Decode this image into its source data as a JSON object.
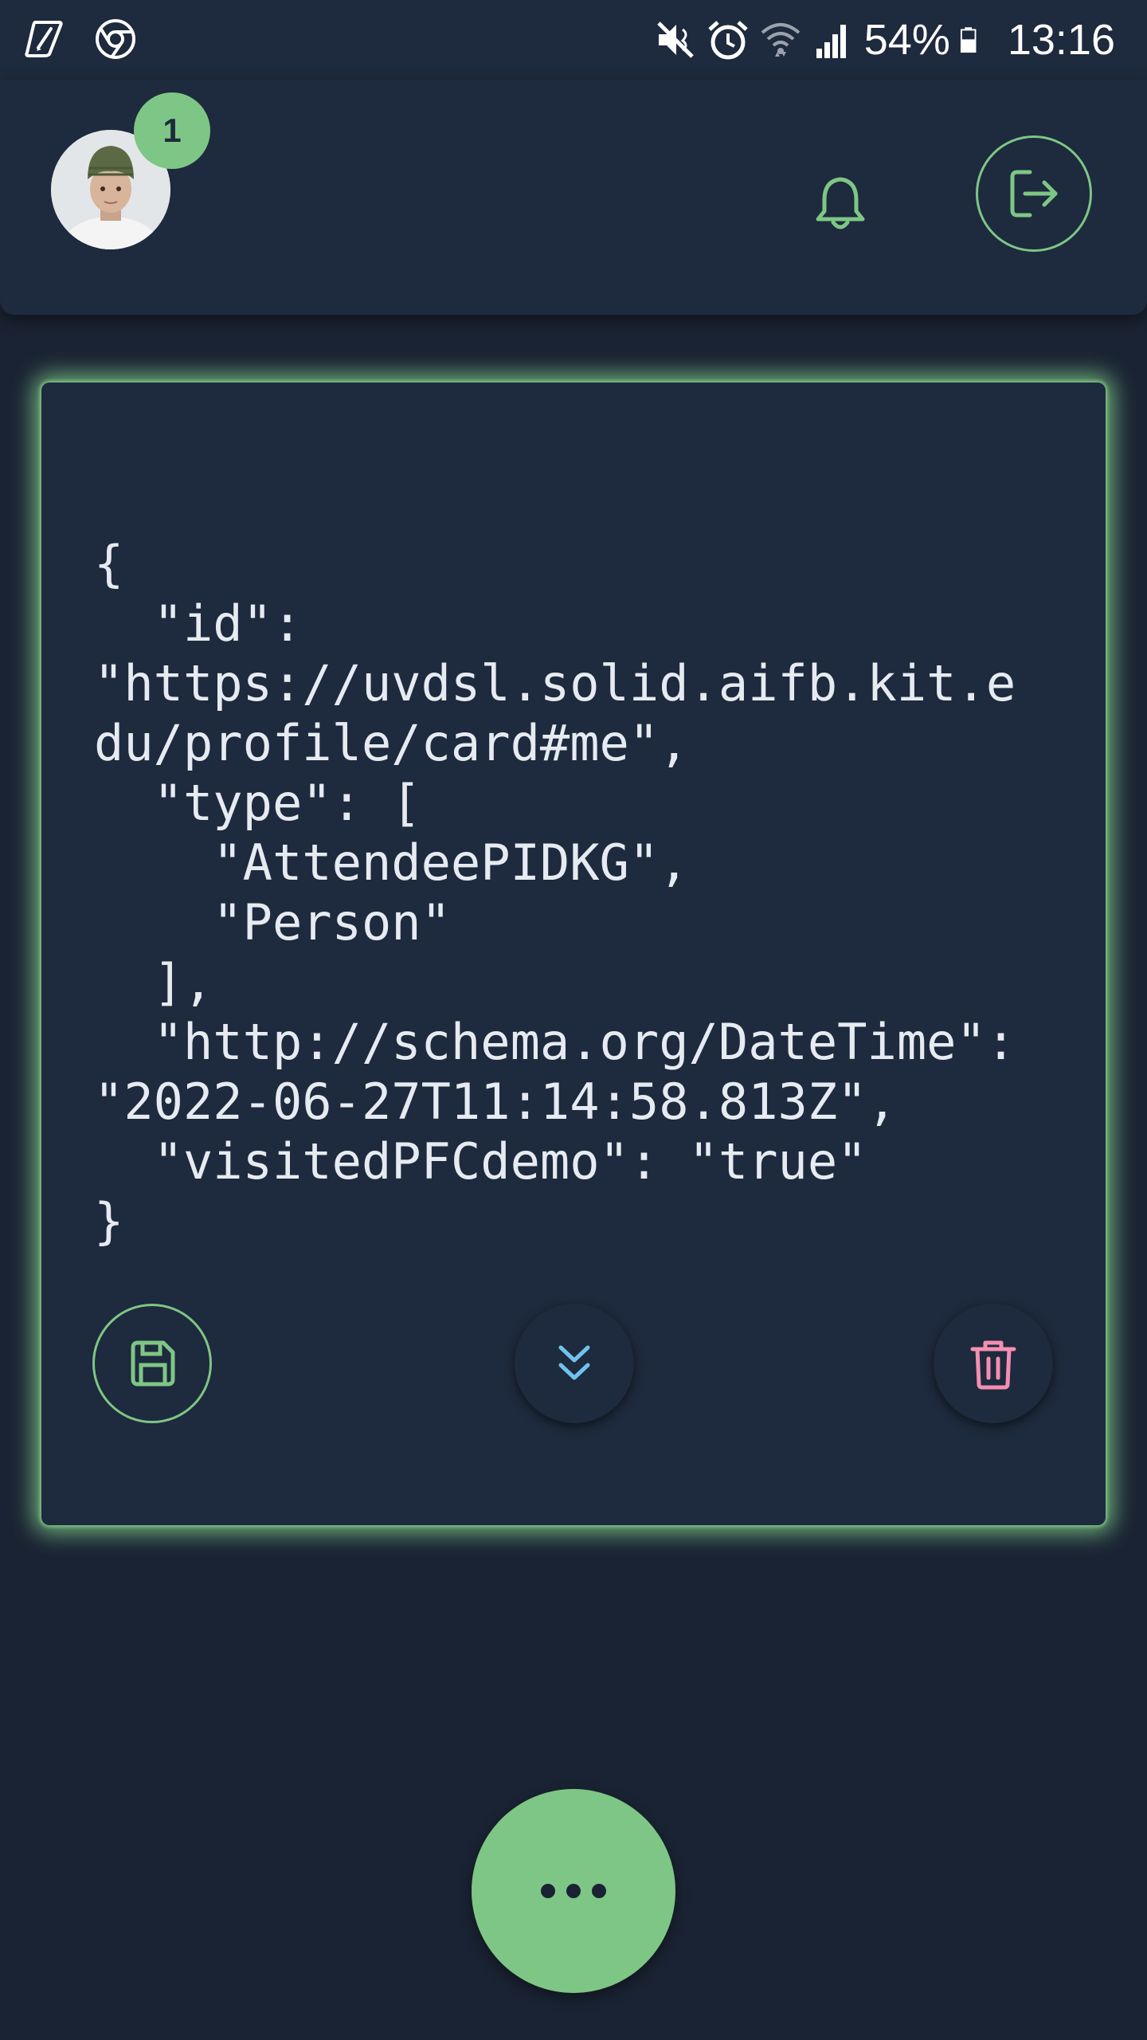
{
  "status_bar": {
    "battery_percent": "54%",
    "clock": "13:16",
    "icons": [
      "pen-app-icon",
      "chrome-icon",
      "mute-icon",
      "alarm-icon",
      "wifi-icon",
      "signal-icon",
      "battery-icon"
    ]
  },
  "header": {
    "notification_count": "1",
    "icons": [
      "avatar",
      "bell-icon",
      "logout-icon"
    ]
  },
  "card": {
    "json_text": "{\n  \"id\":\n\"https://uvdsl.solid.aifb.kit.e\ndu/profile/card#me\",\n  \"type\": [\n    \"AttendeePIDKG\",\n    \"Person\"\n  ],\n  \"http://schema.org/DateTime\":\n\"2022-06-27T11:14:58.813Z\",\n  \"visitedPFCdemo\": \"true\"\n}",
    "buttons": [
      "save-icon",
      "expand-icon",
      "delete-icon"
    ]
  },
  "colors": {
    "background": "#1a2333",
    "surface": "#1e2a3d",
    "accent_green": "#7ec685",
    "accent_blue": "#6fc3ee",
    "accent_pink": "#f48fb1"
  },
  "fab": {
    "icon": "more-horizontal-icon"
  }
}
